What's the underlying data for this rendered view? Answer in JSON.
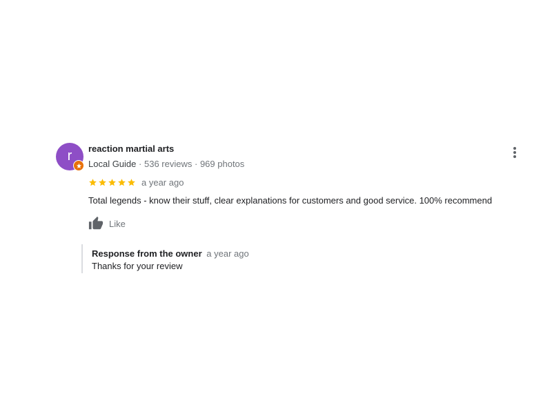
{
  "review": {
    "author": {
      "name": "reaction martial arts",
      "avatar_letter": "r",
      "avatar_color": "#8e4ec6",
      "guide_label": "Local Guide",
      "reviews_count": "536 reviews",
      "photos_count": "969 photos",
      "separator": "·",
      "badge_icon": "local-guide-star-badge"
    },
    "rating": {
      "stars": 5,
      "max_stars": 5,
      "star_color": "#fbbc04"
    },
    "date": "a year ago",
    "text": "Total legends - know their stuff, clear explanations for customers and good service. 100% recommend",
    "like_label": "Like",
    "like_icon": "thumbs-up-icon",
    "more_icon": "more-vertical-icon"
  },
  "owner_response": {
    "title": "Response from the owner",
    "date": "a year ago",
    "text": "Thanks for your review"
  }
}
